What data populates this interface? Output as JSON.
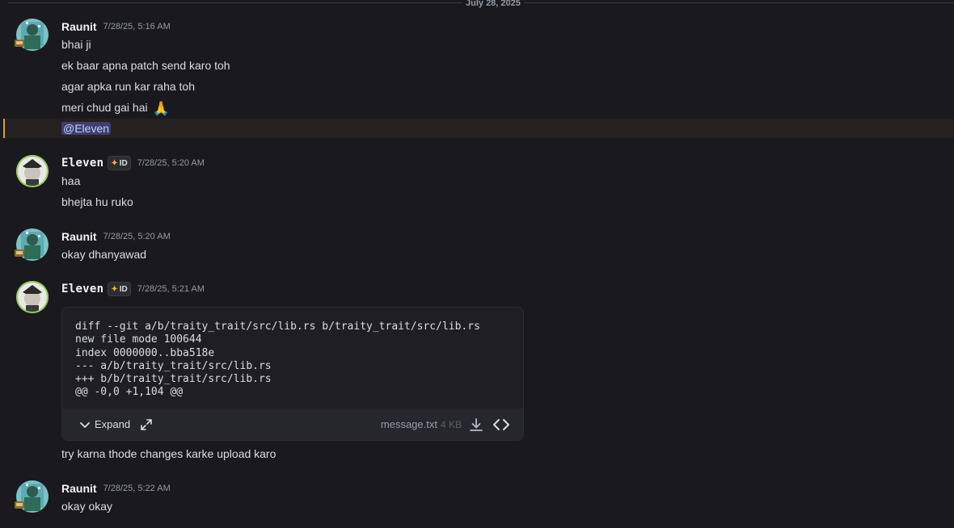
{
  "divider": {
    "label": "July 28, 2025"
  },
  "messages": [
    {
      "author": "Raunit",
      "timestamp": "7/28/25, 5:16 AM",
      "lines": [
        "bhai ji",
        "ek baar apna patch send karo toh",
        "agar apka run kar raha toh",
        "meri chud gai hai"
      ],
      "emoji": "🙏",
      "mention": "@Eleven"
    },
    {
      "author": "Eleven",
      "tag": "ID",
      "timestamp": "7/28/25, 5:20 AM",
      "lines": [
        "haa",
        "bhejta hu ruko"
      ]
    },
    {
      "author": "Raunit",
      "timestamp": "7/28/25, 5:20 AM",
      "lines": [
        "okay dhanyawad"
      ]
    },
    {
      "author": "Eleven",
      "tag": "ID",
      "timestamp": "7/28/25, 5:21 AM",
      "attachment": {
        "code": "diff --git a/b/traity_trait/src/lib.rs b/traity_trait/src/lib.rs\nnew file mode 100644\nindex 0000000..bba518e\n--- a/b/traity_trait/src/lib.rs\n+++ b/b/traity_trait/src/lib.rs\n@@ -0,0 +1,104 @@",
        "expand_label": "Expand",
        "file_name": "message.txt",
        "file_size": "4 KB"
      },
      "lines": [
        "try karna thode changes karke upload karo"
      ]
    },
    {
      "author": "Raunit",
      "timestamp": "7/28/25, 5:22 AM",
      "lines": [
        "okay okay"
      ]
    }
  ],
  "colors": {
    "background": "#1a1a1e",
    "mention_bg": "#3c3f6f",
    "highlight_border": "#d6a039"
  },
  "icons": {
    "tag_emblem": "deer-emblem-icon",
    "expand": "chevron-down-icon",
    "fullscreen": "expand-arrows-icon",
    "download": "download-icon",
    "view_source": "code-icon"
  }
}
